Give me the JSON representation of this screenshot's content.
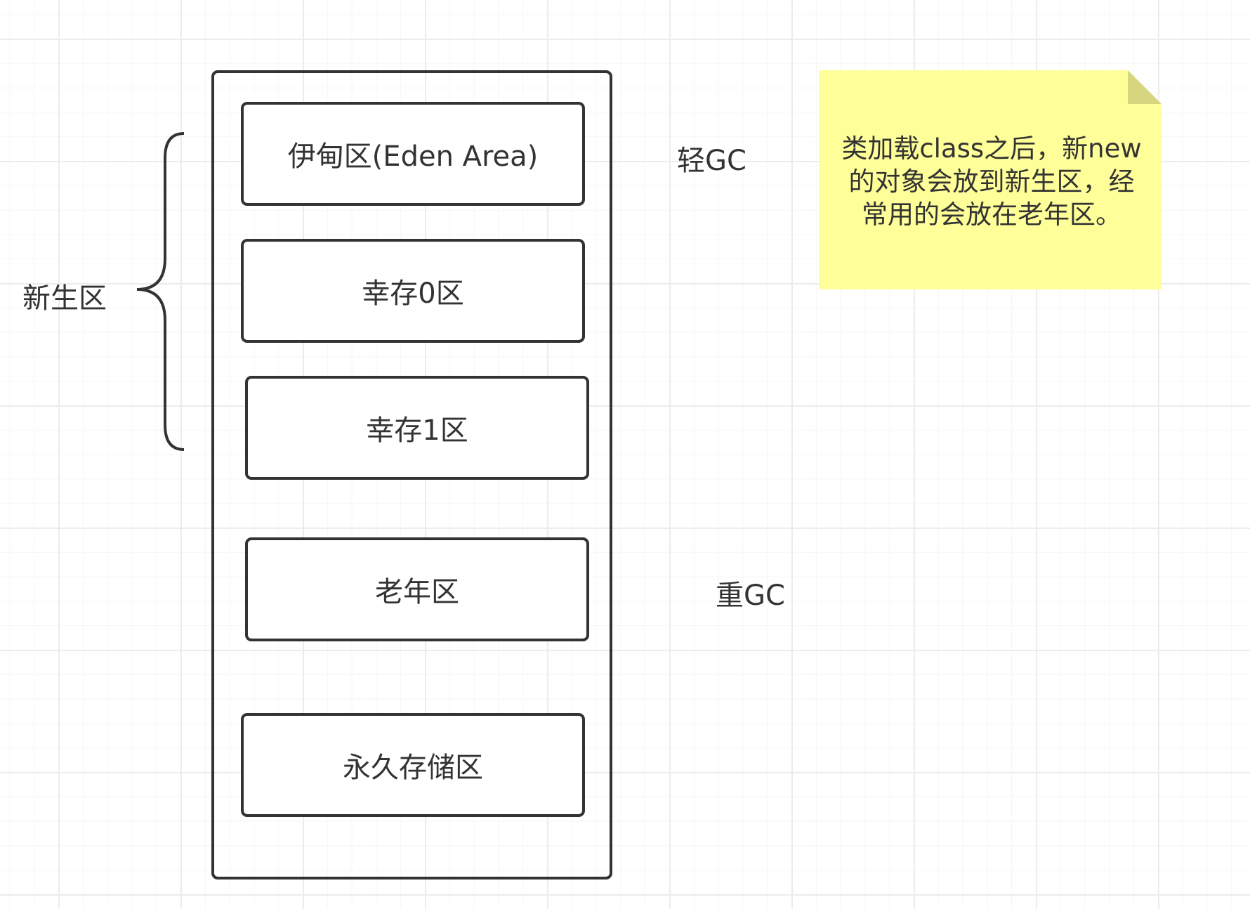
{
  "regions": {
    "eden": "伊甸区(Eden Area)",
    "survivor0": "幸存0区",
    "survivor1": "幸存1区",
    "old": "老年区",
    "permanent": "永久存储区"
  },
  "labels": {
    "young_generation": "新生区",
    "minor_gc": "轻GC",
    "major_gc": "重GC"
  },
  "note": {
    "text": "类加载class之后，新new的对象会放到新生区，经常用的会放在老年区。",
    "color": "#ffff99",
    "fold_color": "#d6d67e"
  }
}
